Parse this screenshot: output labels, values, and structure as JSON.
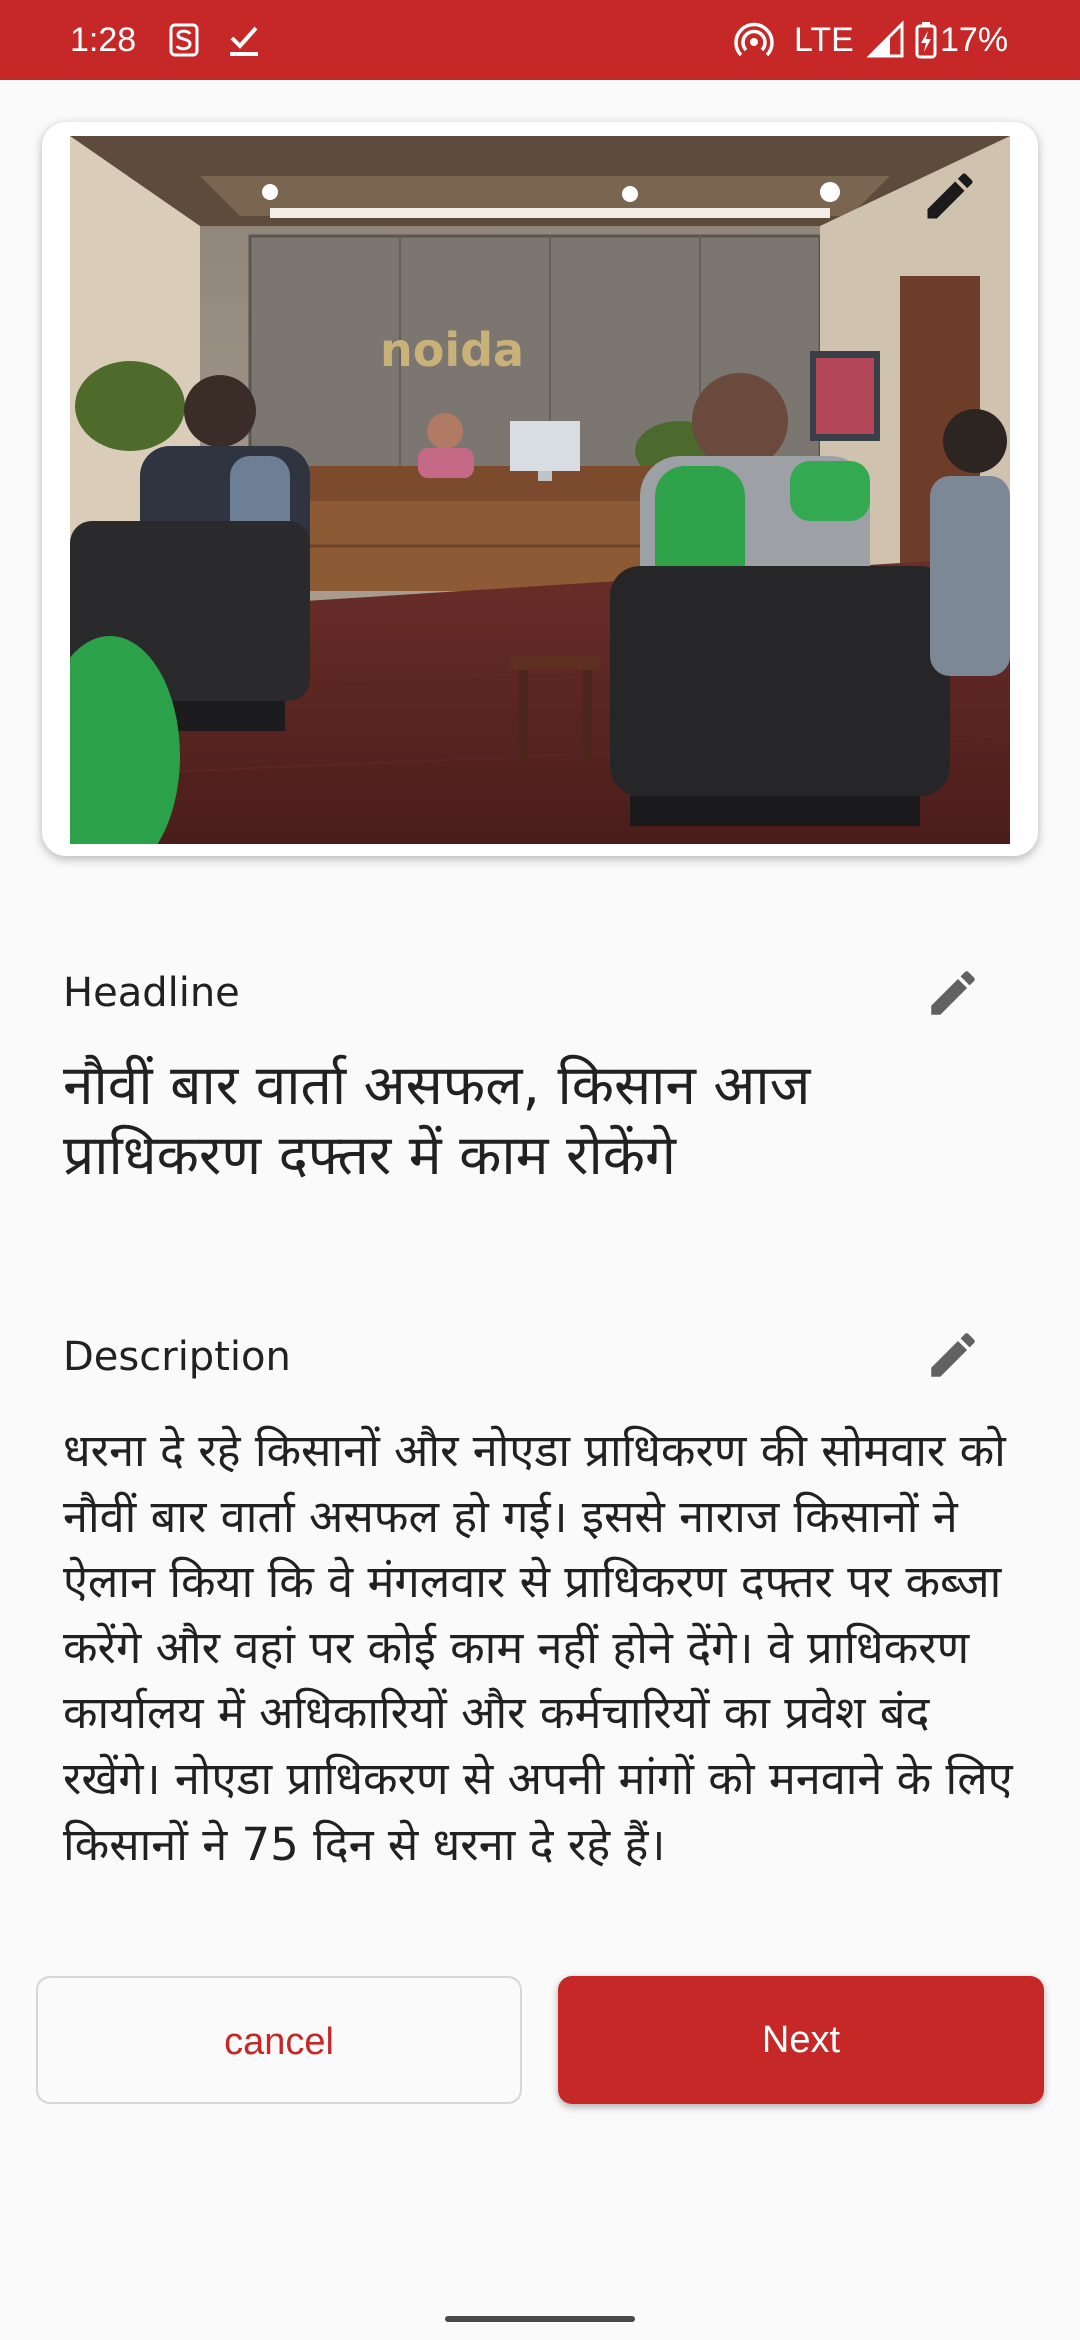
{
  "status_bar": {
    "time": "1:28",
    "network": "LTE",
    "battery": "17%",
    "background": "#c62828"
  },
  "image_card": {
    "photo_alt": "noida",
    "edit_icon": "pencil-icon"
  },
  "headline": {
    "label": "Headline",
    "text": "नौवीं बार वार्ता असफल, किसान आज प्राधिकरण दफ्तर में काम रोकेंगे",
    "edit_icon": "pencil-icon"
  },
  "description": {
    "label": "Description",
    "text": "धरना दे रहे किसानों और नोएडा प्राधिकरण की सोमवार को नौवीं बार वार्ता असफल हो गई। इससे नाराज किसानों ने ऐलान किया कि वे मंगलवार से प्राधिकरण दफ्तर पर कब्जा करेंगे और वहां पर कोई काम नहीं होने देंगे। वे प्राधिकरण कार्यालय में अधिकारियों और कर्मचारियों का प्रवेश बंद रखेंगे। नोएडा प्राधिकरण से अपनी मांगों को मनवाने के लिए किसानों ने 75 दिन से धरना दे रहे हैं।",
    "edit_icon": "pencil-icon"
  },
  "actions": {
    "cancel_label": "cancel",
    "next_label": "Next",
    "accent": "#c62828"
  }
}
